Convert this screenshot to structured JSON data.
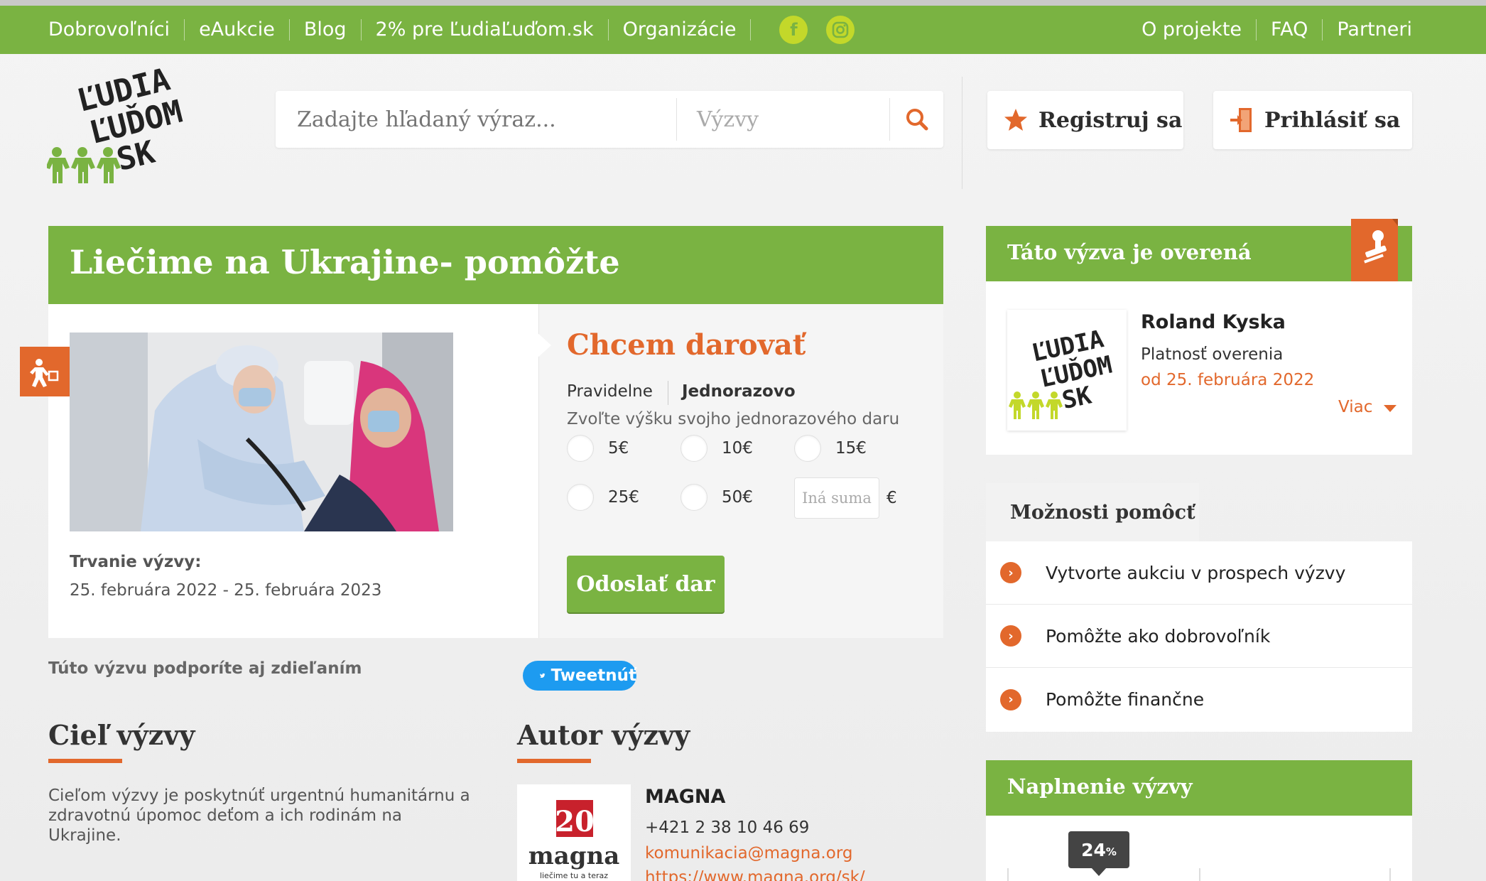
{
  "topnav": {
    "left": [
      "Dobrovoľníci",
      "eAukcie",
      "Blog",
      "2% pre ĽudiaĽuďom.sk",
      "Organizácie"
    ],
    "right": [
      "O projekte",
      "FAQ",
      "Partneri"
    ],
    "social": [
      "facebook-icon",
      "instagram-icon"
    ]
  },
  "logo": {
    "l1": "ĽUDIA",
    "l2": "ĽUĎOM",
    "l3": "SK"
  },
  "search": {
    "placeholder": "Zadajte hľadaný výraz...",
    "category": "Výzvy"
  },
  "header": {
    "register": "Registruj sa",
    "login": "Prihlásiť sa"
  },
  "challenge": {
    "title": "Liečime na Ukrajine- pomôžte",
    "duration_label": "Trvanie výzvy:",
    "duration_value": "25. februára 2022 - 25. februára 2023"
  },
  "donate": {
    "heading": "Chcem darovať",
    "mode_regular": "Pravidelne",
    "mode_once": "Jednorazovo",
    "hint": "Zvoľte výšku svojho jednorazového daru",
    "options": [
      "5€",
      "10€",
      "15€",
      "25€",
      "50€"
    ],
    "other_placeholder": "Iná suma",
    "currency": "€",
    "submit": "Odoslať dar"
  },
  "share": {
    "text": "Túto výzvu podporíte aj zdieľaním",
    "tweet": "Tweetnúť"
  },
  "goal": {
    "heading": "Cieľ výzvy",
    "text": "Cieľom výzvy je poskytnúť urgentnú humanitárnu a zdravotnú úpomoc deťom a ich rodinám na Ukrajine."
  },
  "author": {
    "heading": "Autor výzvy",
    "logo_num": "20",
    "logo_name": "magna",
    "logo_tag": "liečime tu a teraz",
    "name": "MAGNA",
    "phone": "+421 2 38 10 46 69",
    "email": "komunikacia@magna.org",
    "url": "https://www.magna.org/sk/"
  },
  "verified": {
    "heading": "Táto výzva je overená",
    "name": "Roland Kyska",
    "validity_label": "Platnosť overenia",
    "validity_date": "od 25. februára 2022",
    "more": "Viac"
  },
  "help": {
    "heading": "Možnosti pomôcť",
    "items": [
      "Vytvorte aukciu v prospech výzvy",
      "Pomôžte ako dobrovoľník",
      "Pomôžte finančne"
    ]
  },
  "fulfillment": {
    "heading": "Naplnenie výzvy",
    "percent_value": 24,
    "percent_num": "24",
    "percent_sign": "%"
  },
  "colors": {
    "green": "#7ab342",
    "orange": "#e2682c",
    "dark": "#444444"
  }
}
